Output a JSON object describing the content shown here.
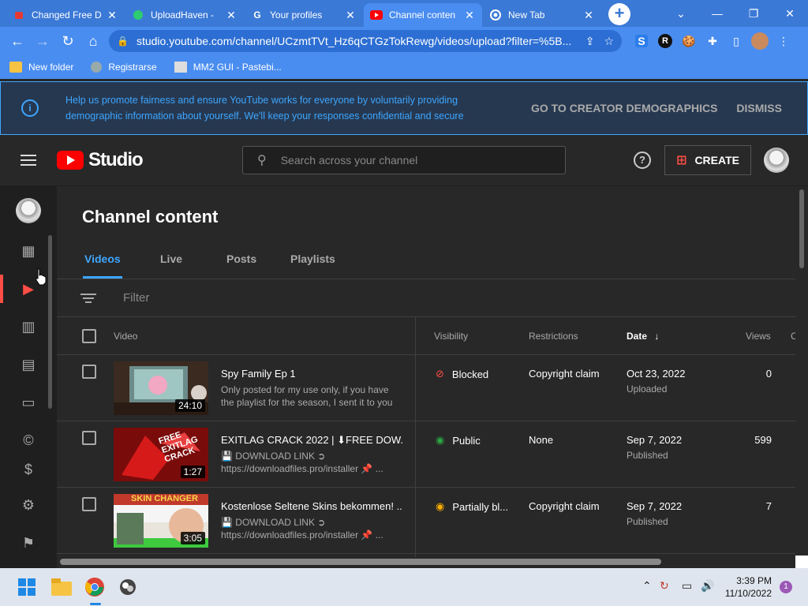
{
  "browser": {
    "tabs": [
      {
        "title": "Changed Free D",
        "active": false
      },
      {
        "title": "UploadHaven -",
        "active": false
      },
      {
        "title": "Your profiles",
        "active": false
      },
      {
        "title": "Channel conten",
        "active": true
      },
      {
        "title": "New Tab",
        "active": false
      }
    ],
    "url": "studio.youtube.com/channel/UCzmtTVt_Hz6qCTGzTokRewg/videos/upload?filter=%5B...",
    "bookmarks": [
      "New folder",
      "Registrarse",
      "MM2 GUI - Pastebi..."
    ]
  },
  "banner": {
    "message": "Help us promote fairness and ensure YouTube works for everyone by voluntarily providing demographic information about yourself. We'll keep your responses confidential and secure",
    "primary": "GO TO CREATOR DEMOGRAPHICS",
    "dismiss": "DISMISS"
  },
  "header": {
    "logo_text": "Studio",
    "search_placeholder": "Search across your channel",
    "create_label": "CREATE"
  },
  "page": {
    "title": "Channel content",
    "tabs": [
      "Videos",
      "Live",
      "Posts",
      "Playlists"
    ],
    "filter_placeholder": "Filter"
  },
  "table": {
    "columns": {
      "video": "Video",
      "visibility": "Visibility",
      "restrictions": "Restrictions",
      "date": "Date",
      "views": "Views",
      "comments": "C"
    },
    "rows": [
      {
        "title": "Spy Family Ep 1",
        "desc1": "Only posted for my use only, if you have",
        "desc2": "the playlist for the season, I sent it to you",
        "duration": "24:10",
        "visibility": "Blocked",
        "vis_color": "#ff4e45",
        "restrictions": "Copyright claim",
        "date": "Oct 23, 2022",
        "date_sub": "Uploaded",
        "views": "0"
      },
      {
        "title": "EXITLAG CRACK 2022 | ⬇FREE DOW...",
        "desc1": "💾 DOWNLOAD LINK ➲",
        "desc2": "https://downloadfiles.pro/installer 📌 ...",
        "duration": "1:27",
        "visibility": "Public",
        "vis_color": "#2ba640",
        "restrictions": "None",
        "date": "Sep 7, 2022",
        "date_sub": "Published",
        "views": "599"
      },
      {
        "title": "Kostenlose Seltene Skins bekommen! ...",
        "desc1": "💾 DOWNLOAD LINK ➲",
        "desc2": "https://downloadfiles.pro/installer 📌 ...",
        "duration": "3:05",
        "visibility": "Partially bl...",
        "vis_color": "#f9ab00",
        "restrictions": "Copyright claim",
        "date": "Sep 7, 2022",
        "date_sub": "Published",
        "views": "7"
      }
    ]
  },
  "taskbar": {
    "time": "3:39 PM",
    "date": "11/10/2022",
    "notifications": "1"
  }
}
